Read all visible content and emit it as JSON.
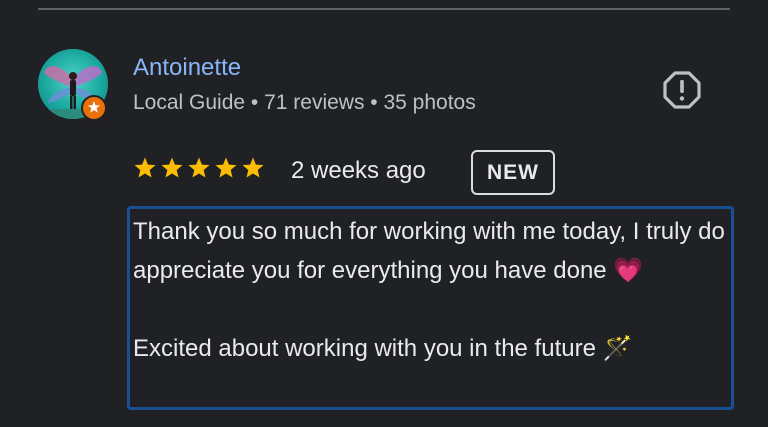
{
  "reviewer": {
    "name": "Antoinette",
    "meta": "Local Guide • 71 reviews • 35 photos"
  },
  "rating": {
    "stars": 5,
    "time": "2 weeks ago",
    "badge": "NEW"
  },
  "review": {
    "text": "Thank you so much for working with me today, I truly do appreciate you for everything you have done 💗\n\nExcited about working with you in the future 🪄"
  },
  "colors": {
    "background": "#202124",
    "name": "#8ab4f8",
    "star": "#fbbc04",
    "guide_badge": "#e8710a",
    "highlight_border": "#1a4f94"
  },
  "icons": {
    "report": "report-icon",
    "guide": "local-guide-icon"
  }
}
